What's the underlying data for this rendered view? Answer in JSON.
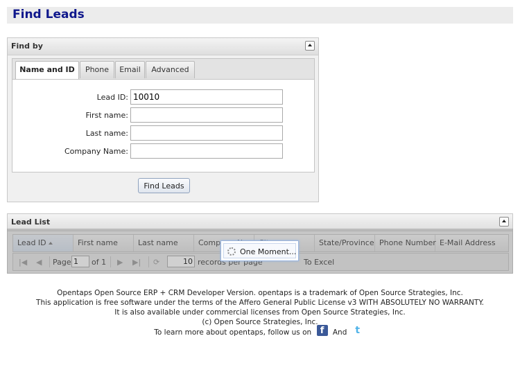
{
  "page": {
    "title": "Find Leads"
  },
  "find_by": {
    "title": "Find by",
    "tabs": [
      {
        "label": "Name and ID",
        "active": true
      },
      {
        "label": "Phone"
      },
      {
        "label": "Email"
      },
      {
        "label": "Advanced"
      }
    ],
    "fields": [
      {
        "label": "Lead ID:",
        "value": "10010"
      },
      {
        "label": "First name:",
        "value": ""
      },
      {
        "label": "Last name:",
        "value": ""
      },
      {
        "label": "Company Name:",
        "value": ""
      }
    ],
    "submit_label": "Find Leads"
  },
  "lead_list": {
    "title": "Lead List",
    "columns": [
      {
        "label": "Lead ID",
        "sorted": "asc"
      },
      {
        "label": "First name"
      },
      {
        "label": "Last name"
      },
      {
        "label": "Company N"
      },
      {
        "label": "City"
      },
      {
        "label": "State/Province"
      },
      {
        "label": "Phone Number"
      },
      {
        "label": "E-Mail Address"
      }
    ],
    "pager": {
      "page_label": "Page",
      "page_value": "1",
      "of_label": "of 1",
      "page_size": "10",
      "records_label": "records per page",
      "export_label": "To Excel"
    },
    "loading_text": "One Moment..."
  },
  "footer": {
    "line1": "Opentaps Open Source ERP + CRM Developer Version. opentaps is a trademark of Open Source Strategies, Inc.",
    "line2": "This application is free software under the terms of the Affero General Public License v3 WITH ABSOLUTELY NO WARRANTY.",
    "line3": "It is also available under commercial licenses from Open Source Strategies, Inc.",
    "line4": "(c) Open Source Strategies, Inc.",
    "line5_prefix": "To learn more about opentaps, follow us on",
    "line5_and": "And",
    "facebook_glyph": "f",
    "twitter_glyph": "t"
  },
  "colors": {
    "title": "#10188c",
    "header_bg": "#ececec",
    "facebook": "#3b5998",
    "twitter": "#4fb3e8"
  }
}
